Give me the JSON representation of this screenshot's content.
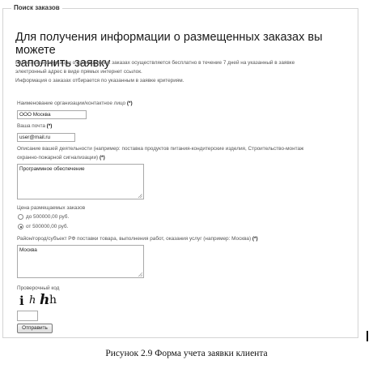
{
  "form": {
    "legend": "Поиск заказов",
    "heading_line1": "Для получения информации о размещенных заказах вы можете",
    "heading_line2": "заполнить заявку",
    "intro_line1": "Рассылка информации о размещенных заказах осуществляется бесплатно в течение 7 дней на указанный в заявке",
    "intro_line2": "электронный адрес в виде прямых интернет ссылок.",
    "intro_line3": "Информация о заказах отбирается по указанным в заявке критериям.",
    "org": {
      "label": "Наименование организации/контактное лицо",
      "required": "(*)",
      "value": "ООО Москва"
    },
    "email": {
      "label": "Ваша почта",
      "required": "(*)",
      "value": "user@mail.ru"
    },
    "activity": {
      "label_line1": "Описание вашей деятельности (например: поставка продуктов питания-кондитерские изделия, Строительство-монтаж",
      "label_line2": "охранно-пожарной сигнализации)",
      "required": "(*)",
      "value": "Программное обеспечение"
    },
    "price": {
      "label": "Цена размещаемых заказов",
      "options": [
        {
          "label": "до 500000,00 руб.",
          "selected": false
        },
        {
          "label": "от 500000,00 руб.",
          "selected": true
        }
      ]
    },
    "region": {
      "label": "Район/город/субъект РФ поставки товара, выполнения работ, оказания услуг (например: Москва)",
      "required": "(*)",
      "value": "Москва"
    },
    "captcha": {
      "label": "Проверочный код",
      "chars": [
        "i",
        "h",
        "h",
        "h"
      ],
      "input_value": ""
    },
    "submit_label": "Отправить"
  },
  "caption": "Рисунок 2.9 Форма учета заявки клиента"
}
